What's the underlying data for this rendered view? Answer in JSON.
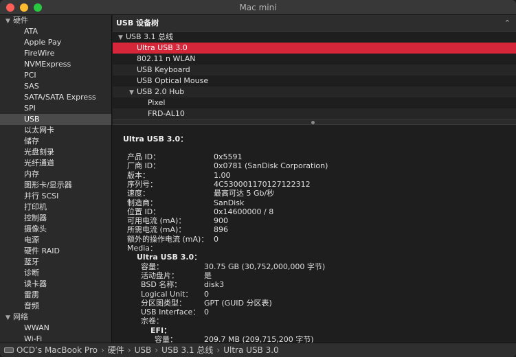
{
  "window": {
    "title": "Mac mini"
  },
  "sidebar": {
    "hardware_label": "硬件",
    "hardware_items": [
      "ATA",
      "Apple Pay",
      "FireWire",
      "NVMExpress",
      "PCI",
      "SAS",
      "SATA/SATA Express",
      "SPI",
      "USB",
      "以太网卡",
      "储存",
      "光盘刻录",
      "光纤通道",
      "内存",
      "图形卡/显示器",
      "并行 SCSI",
      "打印机",
      "控制器",
      "摄像头",
      "电源",
      "硬件 RAID",
      "蓝牙",
      "诊断",
      "读卡器",
      "雷雳",
      "音频"
    ],
    "selected_item": "USB",
    "network_label": "网络",
    "network_items": [
      "WWAN",
      "Wi-Fi"
    ]
  },
  "tree": {
    "header": "USB 设备树",
    "rows": [
      {
        "label": "USB 3.1 总线",
        "level": 0,
        "expanded": true
      },
      {
        "label": "Ultra USB 3.0",
        "level": 1,
        "selected": true
      },
      {
        "label": "802.11 n WLAN",
        "level": 1
      },
      {
        "label": "USB Keyboard",
        "level": 1
      },
      {
        "label": "USB Optical Mouse",
        "level": 1
      },
      {
        "label": "USB 2.0 Hub",
        "level": 1,
        "expanded": true
      },
      {
        "label": "Pixel",
        "level": 2
      },
      {
        "label": "FRD-AL10",
        "level": 2
      }
    ]
  },
  "detail": {
    "title": "Ultra USB 3.0：",
    "props": [
      {
        "key": "产品 ID：",
        "value": "0x5591"
      },
      {
        "key": "厂商 ID：",
        "value": "0x0781  (SanDisk Corporation)"
      },
      {
        "key": "版本：",
        "value": "1.00"
      },
      {
        "key": "序列号：",
        "value": "4C530001170127122312"
      },
      {
        "key": "速度：",
        "value": "最高可达 5 Gb/秒"
      },
      {
        "key": "制造商：",
        "value": "SanDisk"
      },
      {
        "key": "位置 ID：",
        "value": "0x14600000 / 8"
      },
      {
        "key": "可用电流 (mA)：",
        "value": "900"
      },
      {
        "key": "所需电流 (mA)：",
        "value": "896"
      },
      {
        "key": "额外的操作电流 (mA)：",
        "value": "0"
      }
    ],
    "media_label": "Media：",
    "media_name": "Ultra USB 3.0：",
    "media_props": [
      {
        "key": "容量：",
        "value": "30.75 GB (30,752,000,000 字节)"
      },
      {
        "key": "活动盘片：",
        "value": "是"
      },
      {
        "key": "BSD 名称：",
        "value": "disk3"
      },
      {
        "key": "Logical Unit：",
        "value": "0"
      },
      {
        "key": "分区图类型：",
        "value": "GPT (GUID 分区表)"
      },
      {
        "key": "USB Interface：",
        "value": "0"
      }
    ],
    "volumes_label": "宗卷：",
    "volume_name": "EFI：",
    "volume_props": [
      {
        "key": "容量：",
        "value": "209.7 MB (209,715,200 字节)"
      }
    ]
  },
  "pathbar": {
    "items": [
      "OCD’s MacBook Pro",
      "硬件",
      "USB",
      "USB 3.1 总线",
      "Ultra USB 3.0"
    ],
    "separator": "›"
  },
  "colors": {
    "selection_red": "#d6263a",
    "sidebar_selection": "#4a4a4a"
  }
}
